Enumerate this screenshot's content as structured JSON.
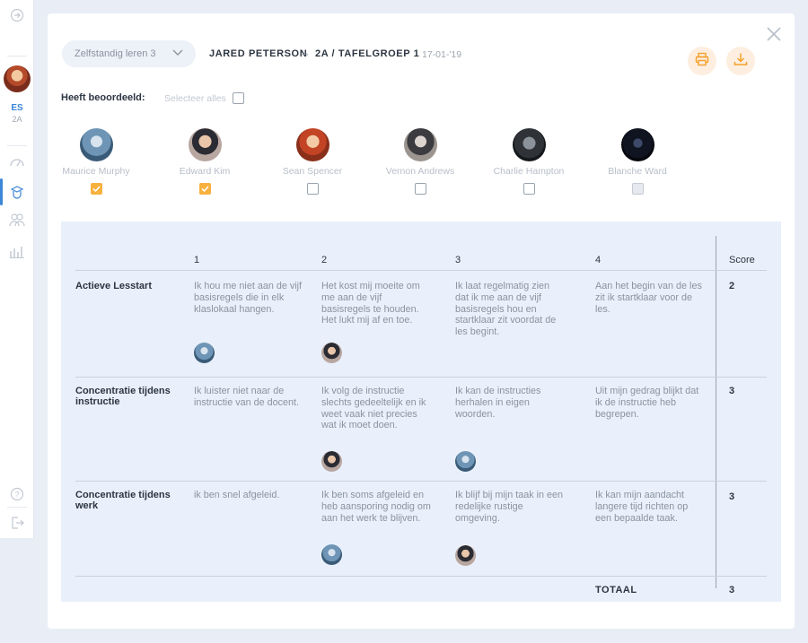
{
  "sidebar": {
    "initials": "ES",
    "class": "2A",
    "items": [
      {
        "icon": "forward-icon"
      },
      {
        "icon": "dashboard-icon"
      },
      {
        "icon": "student-icon"
      },
      {
        "icon": "group-icon"
      },
      {
        "icon": "chart-icon"
      },
      {
        "icon": "help-icon"
      },
      {
        "icon": "logout-icon"
      }
    ]
  },
  "header": {
    "dropdown_value": "Zelfstandig leren 3",
    "student": "JARED PETERSON",
    "arrow": "→",
    "group": "2A / TAFELGROEP 1",
    "date": "17-01-'19",
    "print_icon": "printer-icon",
    "download_icon": "download-icon",
    "accent": "#f5a029"
  },
  "assessed": {
    "label": "Heeft beoordeeld:",
    "select_all": "Selecteer alles",
    "peers": [
      {
        "name": "Maurice Murphy",
        "checked": true
      },
      {
        "name": "Edward Kim",
        "checked": true
      },
      {
        "name": "Sean Spencer",
        "checked": false
      },
      {
        "name": "Vernon Andrews",
        "checked": false
      },
      {
        "name": "Charlie Hampton",
        "checked": false
      },
      {
        "name": "Blanche Ward",
        "checked": false,
        "disabled": true
      }
    ]
  },
  "rubric": {
    "columns": [
      "1",
      "2",
      "3",
      "4"
    ],
    "score_label": "Score",
    "rows": [
      {
        "criterion": "Actieve Lesstart",
        "levels": [
          "Ik hou me niet aan de vijf basisregels die in elk klaslokaal hangen.",
          "Het kost mij moeite om me aan de vijf basisregels te houden. Het lukt mij af en toe.",
          "Ik laat regelmatig zien dat ik me aan de vijf basisregels hou en startklaar zit voordat de les begint.",
          "Aan het begin van de les zit ik startklaar voor de les."
        ],
        "score": "2"
      },
      {
        "criterion": "Concentratie tijdens instructie",
        "levels": [
          "Ik luister niet naar de instructie van de docent.",
          "Ik volg de instructie slechts gedeeltelijk en ik weet vaak niet precies wat ik moet doen.",
          "Ik kan de instructies herhalen in eigen woorden.",
          "Uit mijn gedrag blijkt dat ik de instructie heb begrepen."
        ],
        "score": "3"
      },
      {
        "criterion": "Concentratie tijdens werk",
        "levels": [
          "ik ben snel afgeleid.",
          "Ik ben soms afgeleid en heb aansporing nodig om aan het werk te blijven.",
          "Ik blijf bij mijn taak in een redelijke rustige omgeving.",
          "Ik kan mijn aandacht langere tijd richten op een bepaalde taak."
        ],
        "score": "3"
      }
    ],
    "total_label": "TOTAAL",
    "total": "3"
  }
}
